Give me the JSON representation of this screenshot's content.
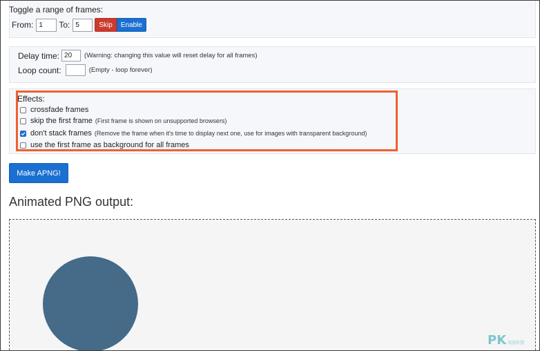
{
  "toggle": {
    "title": "Toggle a range of frames:",
    "from_label": "From:",
    "from_value": "1",
    "to_label": "To:",
    "to_value": "5",
    "skip_label": "Skip",
    "enable_label": "Enable"
  },
  "timing": {
    "delay_label": "Delay time:",
    "delay_value": "20",
    "delay_note": "(Warning: changing this value will reset delay for all frames)",
    "loop_label": "Loop count:",
    "loop_value": "",
    "loop_note": "(Empty - loop forever)"
  },
  "effects": {
    "title": "Effects:",
    "items": [
      {
        "label": "crossfade frames",
        "note": "",
        "checked": false
      },
      {
        "label": "skip the first frame",
        "note": "(First frame is shown on unsupported browsers)",
        "checked": false
      },
      {
        "label": "don't stack frames",
        "note": "(Remove the frame when it's time to display next one, use for images with transparent background)",
        "checked": true
      },
      {
        "label": "use the first frame as background for all frames",
        "note": "",
        "checked": false
      }
    ],
    "highlight_color": "#f0602e"
  },
  "make_button": {
    "label": "Make APNG!"
  },
  "output": {
    "heading": "Animated PNG output:",
    "preview_shape_color": "#456b88"
  },
  "watermark": {
    "main": "PK",
    "sub": "電腦軟體"
  },
  "colors": {
    "primary": "#1a6fd0",
    "danger": "#cc3a2e"
  }
}
